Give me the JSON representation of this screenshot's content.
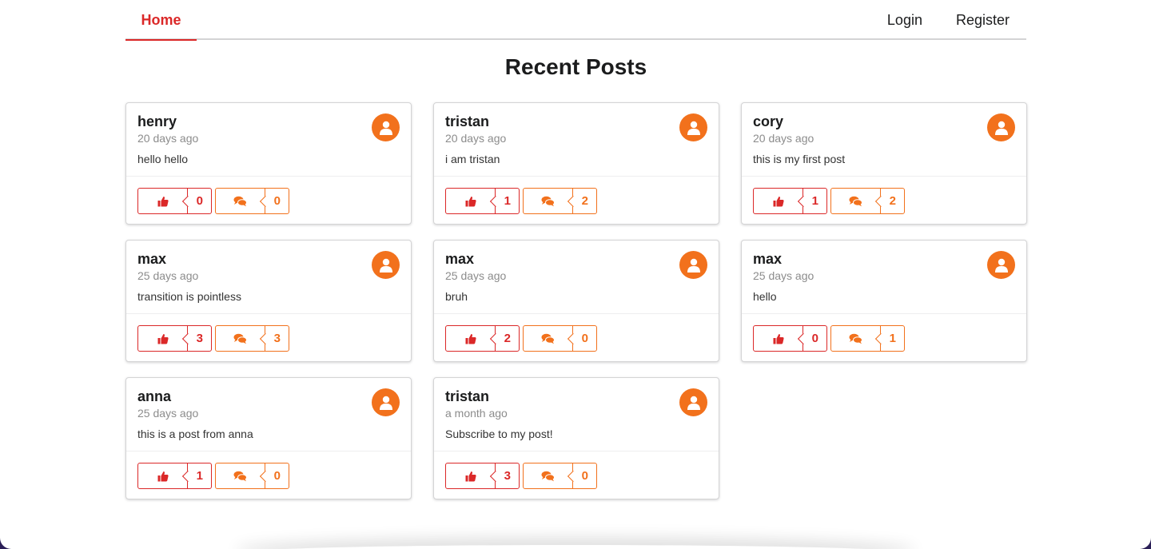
{
  "nav": {
    "home": "Home",
    "login": "Login",
    "register": "Register"
  },
  "page_title": "Recent Posts",
  "colors": {
    "accent_red": "#db2828",
    "accent_orange": "#f2711c"
  },
  "icons": {
    "avatar": "user-icon",
    "like": "thumbs-up-icon",
    "comment": "comments-icon"
  },
  "posts": [
    {
      "author": "henry",
      "time": "20 days ago",
      "body": "hello hello",
      "likes": "0",
      "comments": "0"
    },
    {
      "author": "tristan",
      "time": "20 days ago",
      "body": "i am tristan",
      "likes": "1",
      "comments": "2"
    },
    {
      "author": "cory",
      "time": "20 days ago",
      "body": "this is my first post",
      "likes": "1",
      "comments": "2"
    },
    {
      "author": "max",
      "time": "25 days ago",
      "body": "transition is pointless",
      "likes": "3",
      "comments": "3"
    },
    {
      "author": "max",
      "time": "25 days ago",
      "body": "bruh",
      "likes": "2",
      "comments": "0"
    },
    {
      "author": "max",
      "time": "25 days ago",
      "body": "hello",
      "likes": "0",
      "comments": "1"
    },
    {
      "author": "anna",
      "time": "25 days ago",
      "body": "this is a post from anna",
      "likes": "1",
      "comments": "0"
    },
    {
      "author": "tristan",
      "time": "a month ago",
      "body": "Subscribe to my post!",
      "likes": "3",
      "comments": "0"
    }
  ]
}
